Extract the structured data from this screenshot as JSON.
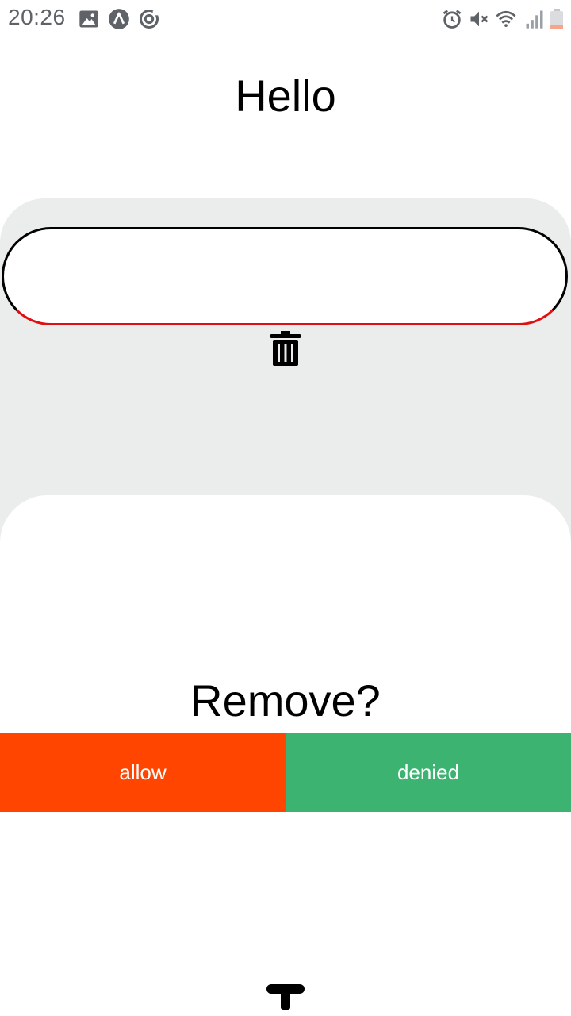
{
  "status_bar": {
    "time": "20:26",
    "left_icons": [
      "image-icon",
      "app-a-icon",
      "sync-icon"
    ],
    "right_icons": [
      "alarm-icon",
      "mute-icon",
      "wifi-icon",
      "signal-icon",
      "battery-icon"
    ]
  },
  "page": {
    "title": "Hello"
  },
  "input": {
    "value": "",
    "border_color": "#000000",
    "underline_color": "#e01010"
  },
  "dialog": {
    "title": "Remove?",
    "allow_label": "allow",
    "denied_label": "denied",
    "allow_color": "#ff4500",
    "denied_color": "#3cb371"
  },
  "icons": {
    "delete": "trash-icon",
    "handle": "t-handle-icon"
  }
}
